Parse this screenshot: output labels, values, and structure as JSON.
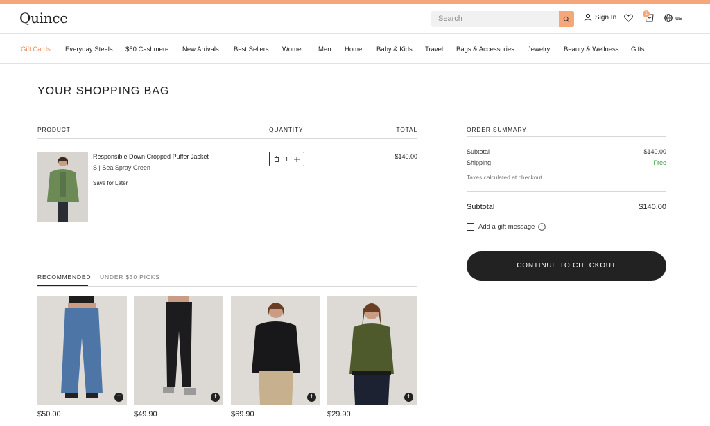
{
  "brand": {
    "logo": "Quince",
    "accent": "#f5a77a"
  },
  "header": {
    "search_placeholder": "Search",
    "sign_in": "Sign In",
    "cart_count": "1",
    "locale": "us"
  },
  "nav": [
    "Gift Cards",
    "Everyday Steals",
    "$50 Cashmere",
    "New Arrivals",
    "Best Sellers",
    "Women",
    "Men",
    "Home",
    "Baby & Kids",
    "Travel",
    "Bags & Accessories",
    "Jewelry",
    "Beauty & Wellness",
    "Gifts"
  ],
  "bag": {
    "title": "YOUR SHOPPING BAG",
    "col_product": "PRODUCT",
    "col_quantity": "QUANTITY",
    "col_total": "TOTAL",
    "item": {
      "name": "Responsible Down Cropped Puffer Jacket",
      "variant": "S  |  Sea Spray Green",
      "save_later": "Save for Later",
      "quantity": "1",
      "total": "$140.00"
    }
  },
  "summary": {
    "title": "ORDER SUMMARY",
    "subtotal_label": "Subtotal",
    "subtotal_value": "$140.00",
    "shipping_label": "Shipping",
    "shipping_value": "Free",
    "tax_note": "Taxes calculated at checkout",
    "total_label": "Subtotal",
    "total_value": "$140.00",
    "gift_label": "Add a gift message",
    "checkout": "CONTINUE TO CHECKOUT"
  },
  "recs": {
    "tabs": [
      "RECOMMENDED",
      "UNDER $30 PICKS"
    ],
    "active_tab": "RECOMMENDED",
    "items": [
      {
        "price": "$50.00"
      },
      {
        "price": "$49.90"
      },
      {
        "price": "$69.90"
      },
      {
        "price": "$29.90"
      }
    ]
  }
}
